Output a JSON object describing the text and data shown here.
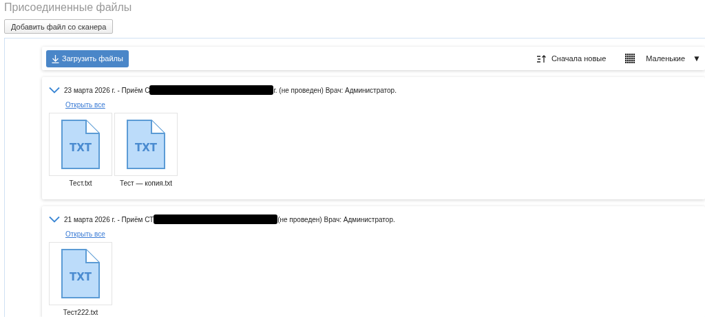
{
  "page_title": "Присоединенные файлы",
  "scanner_button": "Добавить файл со сканера",
  "toolbar": {
    "upload_button": "Загрузить файлы",
    "sort": "Сначала новые",
    "size": "Маленькие",
    "size_caret": "▼"
  },
  "groups": [
    {
      "title_start": "23 марта 2026 г. - Приём С",
      "redacted": true,
      "title_end": "г. (не проведен) Врач: Администратор.",
      "expanded": true,
      "open_all": "Открыть все",
      "files": [
        {
          "name": "Тест.txt",
          "type_label": "TXT"
        },
        {
          "name": "Тест — копия.txt",
          "type_label": "TXT"
        }
      ]
    },
    {
      "title_start": "21 марта 2026 г. - Приём СТ",
      "redacted": true,
      "title_end": "(не проведен) Врач: Администратор.",
      "expanded": true,
      "open_all": "Открыть все",
      "files": [
        {
          "name": "Тест222.txt",
          "type_label": "TXT"
        }
      ]
    }
  ]
}
